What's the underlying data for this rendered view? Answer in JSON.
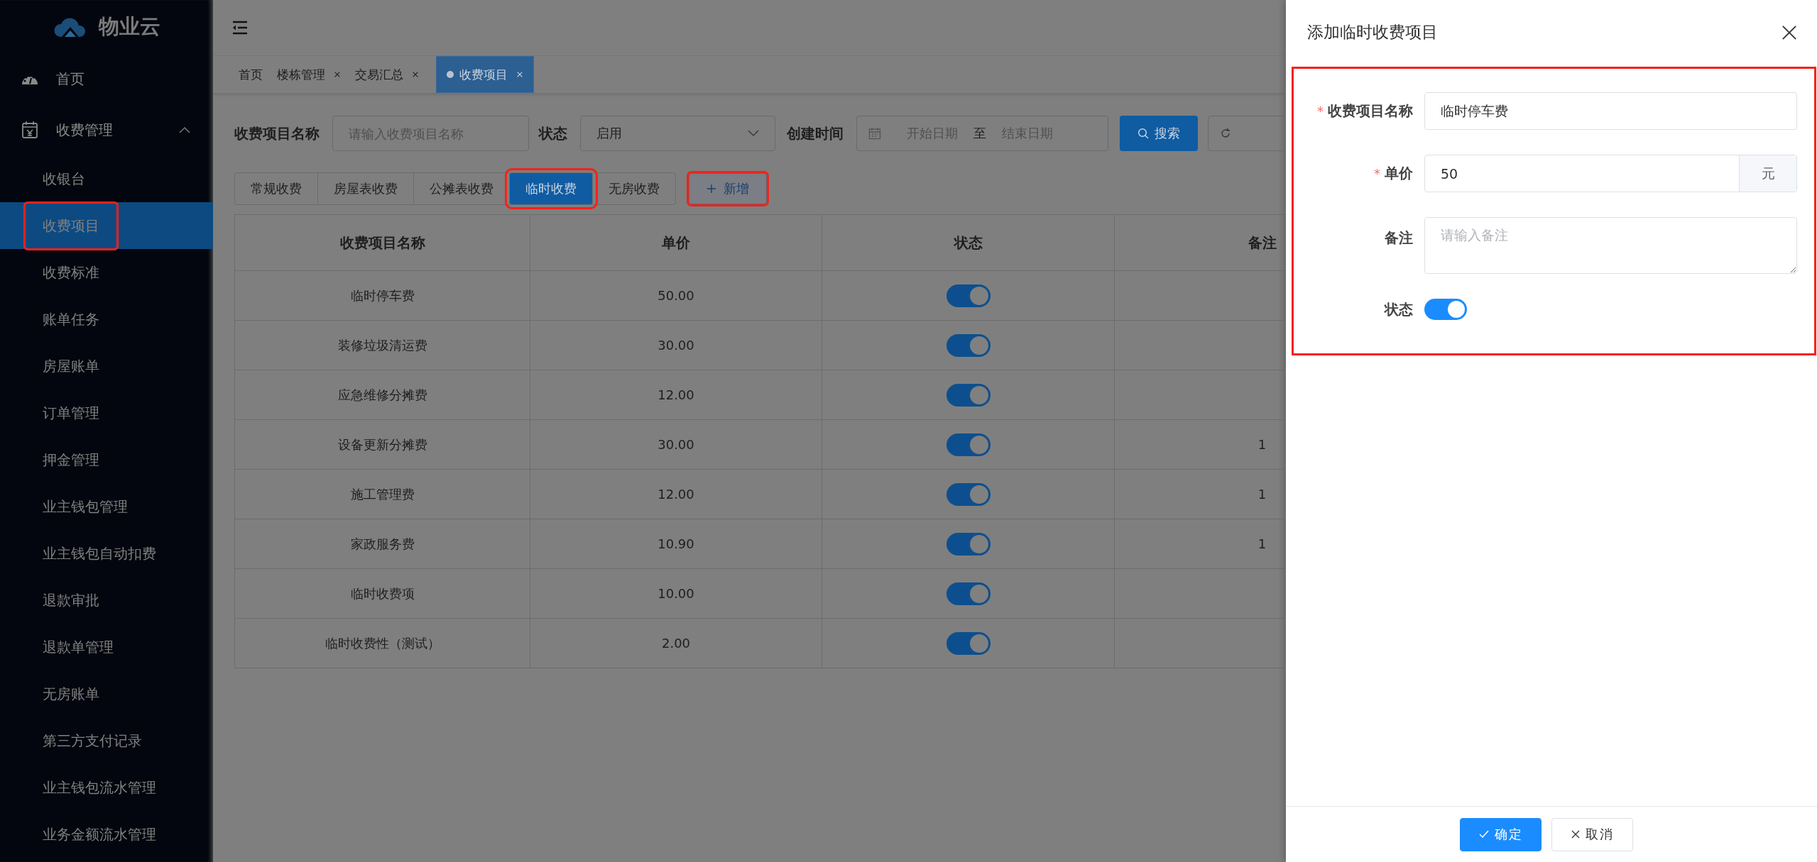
{
  "sidebar": {
    "logo": "物业云",
    "home": {
      "label": "首页"
    },
    "group": {
      "label": "收费管理",
      "expanded": true,
      "children": [
        {
          "label": "收银台",
          "selected": false,
          "highlighted": false
        },
        {
          "label": "收费项目",
          "selected": true,
          "highlighted": true
        },
        {
          "label": "收费标准",
          "selected": false,
          "highlighted": false
        },
        {
          "label": "账单任务",
          "selected": false,
          "highlighted": false
        },
        {
          "label": "房屋账单",
          "selected": false,
          "highlighted": false
        },
        {
          "label": "订单管理",
          "selected": false,
          "highlighted": false
        },
        {
          "label": "押金管理",
          "selected": false,
          "highlighted": false
        },
        {
          "label": "业主钱包管理",
          "selected": false,
          "highlighted": false
        },
        {
          "label": "业主钱包自动扣费",
          "selected": false,
          "highlighted": false
        },
        {
          "label": "退款审批",
          "selected": false,
          "highlighted": false
        },
        {
          "label": "退款单管理",
          "selected": false,
          "highlighted": false
        },
        {
          "label": "无房账单",
          "selected": false,
          "highlighted": false
        },
        {
          "label": "第三方支付记录",
          "selected": false,
          "highlighted": false
        },
        {
          "label": "业主钱包流水管理",
          "selected": false,
          "highlighted": false
        },
        {
          "label": "业务金额流水管理",
          "selected": false,
          "highlighted": false
        }
      ]
    }
  },
  "page_tabs": [
    {
      "label": "首页",
      "closable": false,
      "selected": false
    },
    {
      "label": "楼栋管理",
      "closable": true,
      "selected": false
    },
    {
      "label": "交易汇总",
      "closable": true,
      "selected": false
    },
    {
      "label": "收费项目",
      "closable": true,
      "selected": true
    }
  ],
  "filters": {
    "name": {
      "label": "收费项目名称",
      "placeholder": "请输入收费项目名称"
    },
    "status": {
      "label": "状态",
      "value": "启用"
    },
    "created": {
      "label": "创建时间",
      "start_placeholder": "开始日期",
      "separator": "至",
      "end_placeholder": "结束日期"
    },
    "search_button": "搜索"
  },
  "category_tabs": [
    {
      "label": "常规收费",
      "selected": false,
      "highlighted": false
    },
    {
      "label": "房屋表收费",
      "selected": false,
      "highlighted": false
    },
    {
      "label": "公摊表收费",
      "selected": false,
      "highlighted": false
    },
    {
      "label": "临时收费",
      "selected": true,
      "highlighted": true
    },
    {
      "label": "无房收费",
      "selected": false,
      "highlighted": false
    }
  ],
  "add_button": {
    "label": "新增",
    "highlighted": true
  },
  "table": {
    "columns": [
      "收费项目名称",
      "单价",
      "状态",
      "备注"
    ],
    "rows": [
      {
        "name": "临时停车费",
        "price": "50.00",
        "enabled": true
      },
      {
        "name": "装修垃圾清运费",
        "price": "30.00",
        "enabled": true
      },
      {
        "name": "应急维修分摊费",
        "price": "12.00",
        "enabled": true
      },
      {
        "name": "设备更新分摊费",
        "price": "30.00",
        "enabled": true,
        "remark": "1"
      },
      {
        "name": "施工管理费",
        "price": "12.00",
        "enabled": true,
        "remark": "1"
      },
      {
        "name": "家政服务费",
        "price": "10.90",
        "enabled": true,
        "remark": "1"
      },
      {
        "name": "临时收费项",
        "price": "10.00",
        "enabled": true
      },
      {
        "name": "临时收费性（测试）",
        "price": "2.00",
        "enabled": true
      }
    ]
  },
  "drawer": {
    "title": "添加临时收费项目",
    "form": {
      "highlighted": true,
      "fields": [
        {
          "kind": "text",
          "marker": "*",
          "label": "收费项目名称",
          "value": "临时停车费"
        },
        {
          "kind": "money",
          "marker": "*",
          "label": "单价",
          "value": "50",
          "suffix": "元"
        },
        {
          "kind": "textarea",
          "label": "备注",
          "placeholder": "请输入备注"
        },
        {
          "kind": "switch",
          "label": "状态",
          "on": true
        }
      ]
    },
    "buttons": [
      {
        "kind": "primary",
        "label": "确定"
      },
      {
        "kind": "default",
        "label": "取消"
      }
    ]
  }
}
